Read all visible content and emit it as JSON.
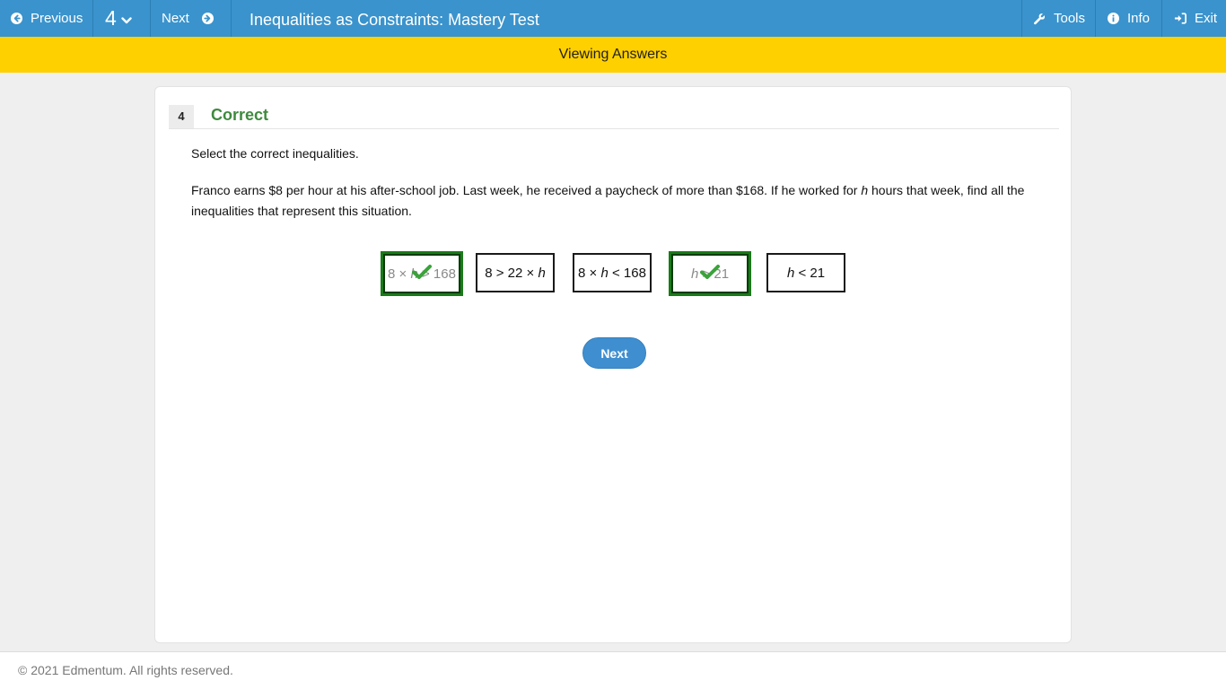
{
  "topbar": {
    "previous_label": "Previous",
    "question_number": "4",
    "next_label": "Next",
    "title": "Inequalities as Constraints: Mastery Test",
    "tools_label": "Tools",
    "info_label": "Info",
    "exit_label": "Exit",
    "background": "#3a93cc"
  },
  "banner": {
    "text": "Viewing Answers",
    "color": "#ffd000"
  },
  "question": {
    "number": "4",
    "status": "Correct",
    "status_color": "#3f8a3f",
    "instruction": "Select the correct inequalities.",
    "text_before": "Franco earns $8 per hour at his after-school job. Last week, he received a paycheck of more than $168. If he worked for ",
    "variable": "h",
    "text_after": " hours that week, find all the inequalities that represent this situation.",
    "choices": [
      {
        "pre": "8 × ",
        "var": "h",
        "post": " > 168",
        "selected": true,
        "correct": true
      },
      {
        "pre": "8 > 22 × ",
        "var": "h",
        "post": "",
        "selected": false,
        "correct": false
      },
      {
        "pre": "8 × ",
        "var": "h",
        "post": " < 168",
        "selected": false,
        "correct": false
      },
      {
        "pre": "",
        "var": "h",
        "post": " > 21",
        "selected": true,
        "correct": true
      },
      {
        "pre": "",
        "var": "h",
        "post": " < 21",
        "selected": false,
        "correct": false
      }
    ],
    "next_button": "Next"
  },
  "footer": {
    "copyright": "© 2021 Edmentum. All rights reserved."
  },
  "icons": {
    "previous": "arrow-circle-left-icon",
    "dropdown": "chevron-down-icon",
    "next": "arrow-circle-right-icon",
    "tools": "wrench-icon",
    "info": "info-circle-icon",
    "exit": "sign-in-icon",
    "correct": "checkmark-icon"
  }
}
